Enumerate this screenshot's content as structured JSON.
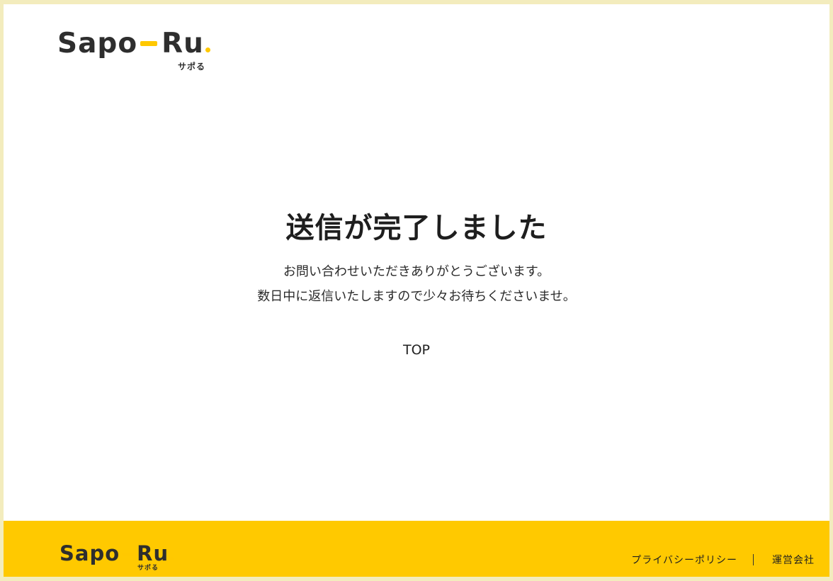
{
  "header": {
    "logo": {
      "main": "Sapo",
      "tail": "Ru",
      "kana": "サポる",
      "accent": "#ffc800"
    }
  },
  "main": {
    "title": "送信が完了しました",
    "message_line1": "お問い合わせいただきありがとうございます。",
    "message_line2": "数日中に返信いたしますので少々お待ちくださいませ。",
    "top_link": "TOP"
  },
  "footer": {
    "background": "#ffc900",
    "logo": {
      "main": "Sapo",
      "tail": "Ru",
      "kana": "サポる"
    },
    "links": [
      "プライバシーポリシー",
      "運営会社"
    ]
  }
}
